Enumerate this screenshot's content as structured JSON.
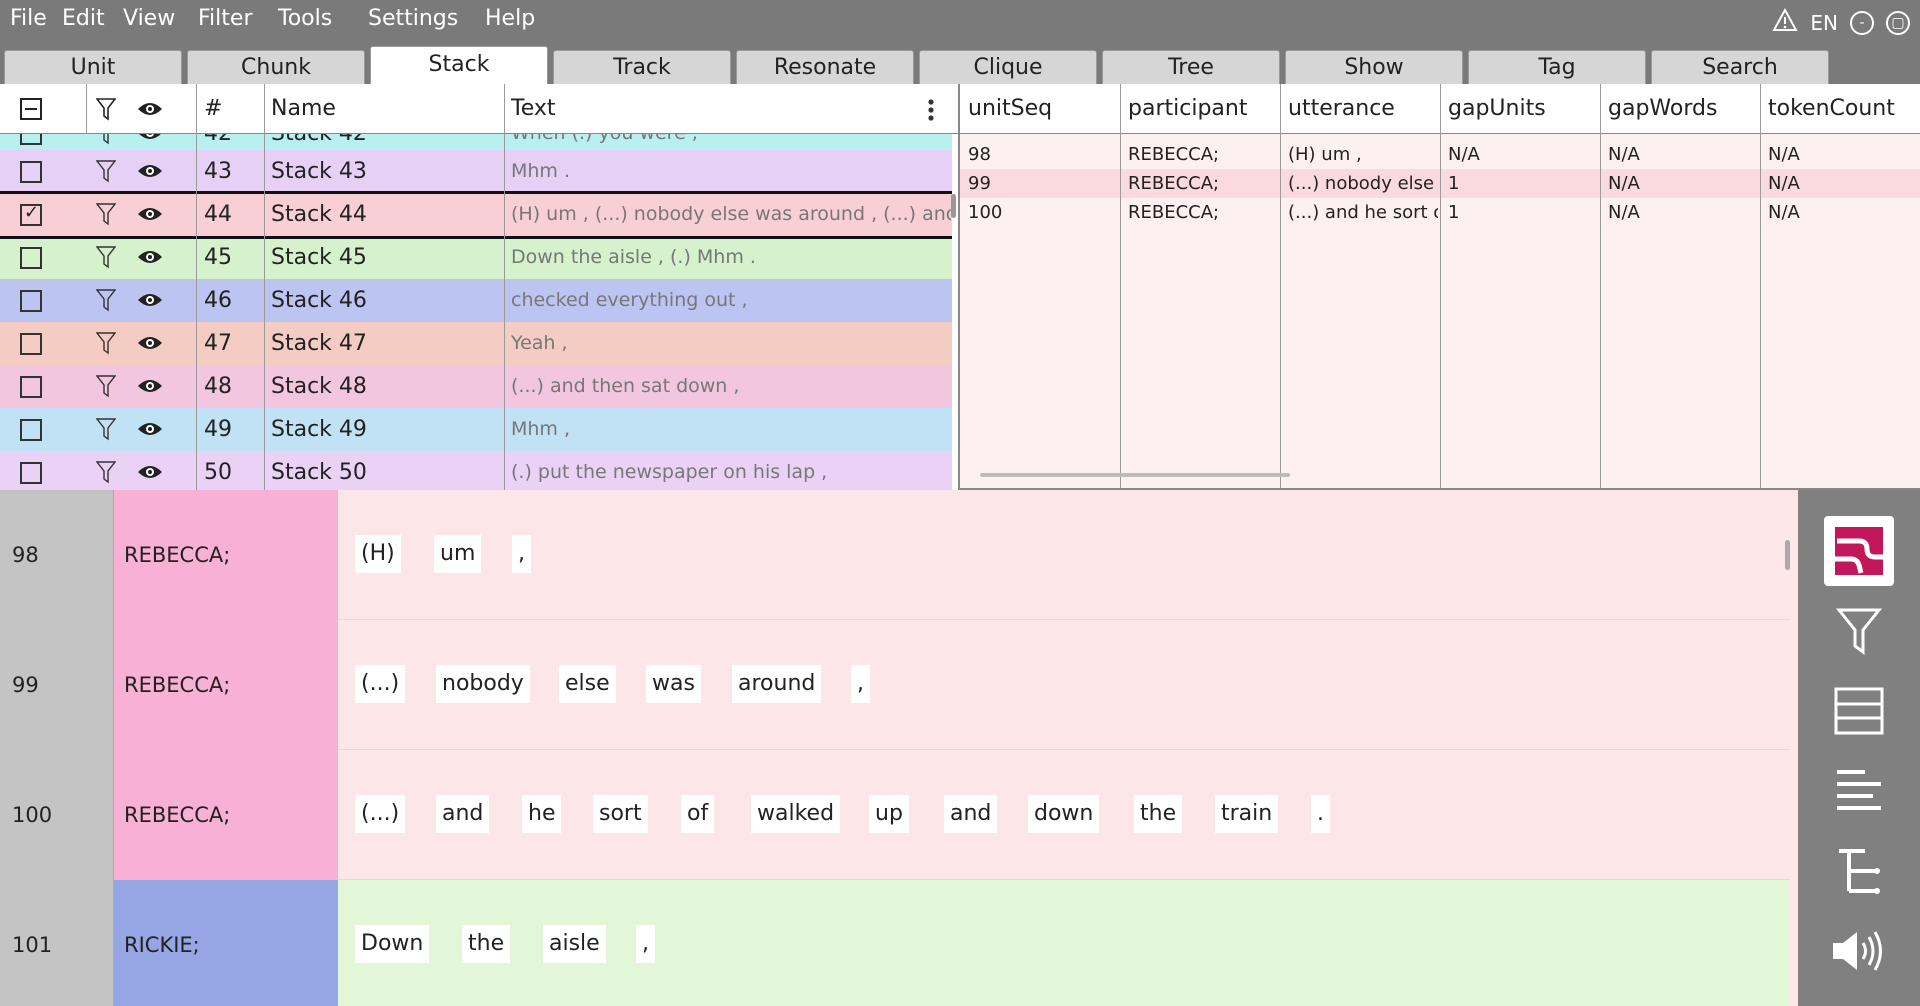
{
  "menu": [
    "File",
    "Edit",
    "View",
    "Filter",
    "Tools",
    "Settings",
    "Help"
  ],
  "menu_right": {
    "lang": "EN",
    "minimize": "-",
    "restore": "▢"
  },
  "tabs": [
    "Unit",
    "Chunk",
    "Stack",
    "Track",
    "Resonate",
    "Clique",
    "Tree",
    "Show",
    "Tag",
    "Search"
  ],
  "active_tab": "Stack",
  "stack_table": {
    "headers": {
      "num": "#",
      "name": "Name",
      "text": "Text"
    },
    "rows": [
      {
        "num": "42",
        "name": "Stack 42",
        "text": "When (.) you were ,",
        "color": "#b8f0f0",
        "checked": false
      },
      {
        "num": "43",
        "name": "Stack 43",
        "text": "Mhm .",
        "color": "#e6d0f6",
        "checked": false
      },
      {
        "num": "44",
        "name": "Stack 44",
        "text": "(H) um ,  (...) nobody else was around ,  (...) and he sort of walked up and down the train .",
        "color": "#f9cfd6",
        "checked": true
      },
      {
        "num": "45",
        "name": "Stack 45",
        "text": "Down the aisle ,  (.) Mhm .",
        "color": "#d5f2cc",
        "checked": false
      },
      {
        "num": "46",
        "name": "Stack 46",
        "text": "checked everything out ,",
        "color": "#bcc4f2",
        "checked": false
      },
      {
        "num": "47",
        "name": "Stack 47",
        "text": "Yeah ,",
        "color": "#f4ccc4",
        "checked": false
      },
      {
        "num": "48",
        "name": "Stack 48",
        "text": "(...) and then sat down ,",
        "color": "#f2c6de",
        "checked": false
      },
      {
        "num": "49",
        "name": "Stack 49",
        "text": "Mhm ,",
        "color": "#c0e2f4",
        "checked": false
      },
      {
        "num": "50",
        "name": "Stack 50",
        "text": "(.) put the newspaper on his lap ,",
        "color": "#ead2f6",
        "checked": false
      }
    ]
  },
  "attr_table": {
    "headers": [
      "unitSeq",
      "participant",
      "utterance",
      "gapUnits",
      "gapWords",
      "tokenCount"
    ],
    "rows": [
      [
        "98",
        "REBECCA;",
        "(H) um ,",
        "N/A",
        "N/A",
        "N/A"
      ],
      [
        "99",
        "REBECCA;",
        "(...) nobody else was around ,",
        "1",
        "N/A",
        "N/A"
      ],
      [
        "100",
        "REBECCA;",
        "(...) and he sort of walked up and down the train .",
        "1",
        "N/A",
        "N/A"
      ]
    ]
  },
  "units": [
    {
      "num": "98",
      "speaker": "REBECCA;",
      "speaker_color": "#f8b0d4",
      "bg": "#fde6e8",
      "words": [
        "(H)",
        "um",
        ","
      ]
    },
    {
      "num": "99",
      "speaker": "REBECCA;",
      "speaker_color": "#f8b0d4",
      "bg": "#fde6e8",
      "words": [
        "(...)",
        "nobody",
        "else",
        "was",
        "around",
        ","
      ]
    },
    {
      "num": "100",
      "speaker": "REBECCA;",
      "speaker_color": "#f8b0d4",
      "bg": "#fde6e8",
      "words": [
        "(...)",
        "and",
        "he",
        "sort",
        "of",
        "walked",
        "up",
        "and",
        "down",
        "the",
        "train",
        "."
      ]
    },
    {
      "num": "101",
      "speaker": "RICKIE;",
      "speaker_color": "#96a6e4",
      "bg": "#e2f6d8",
      "words": [
        "Down",
        "the",
        "aisle",
        ","
      ]
    }
  ],
  "toolbar": [
    "resonate-logo-icon",
    "filter-icon",
    "rows-icon",
    "align-icon",
    "tree-icon",
    "speaker-icon"
  ],
  "colors": {
    "accent": "#c2185b",
    "chrome": "#7a7a7a"
  }
}
